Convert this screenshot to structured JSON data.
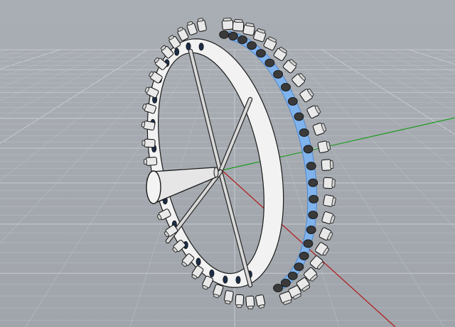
{
  "viewport": {
    "label": "",
    "projection": "perspective",
    "display_mode": "shaded",
    "show_grid": true,
    "show_axes": true
  },
  "colors": {
    "background": "#a3a8ae",
    "grid_minor": "#b3b8be",
    "grid_major": "#c3c8ce",
    "axis_x": "#b01818",
    "axis_y": "#1e9a1e",
    "object_fill": "#e9e9e9",
    "object_edge": "#1a1a1a",
    "selection_highlight": "#7fb4f0"
  },
  "scene": {
    "object": "wheel",
    "rim_segments": 48,
    "spokes": 4,
    "hub": "cone",
    "selected_region": "rim-right-side"
  }
}
